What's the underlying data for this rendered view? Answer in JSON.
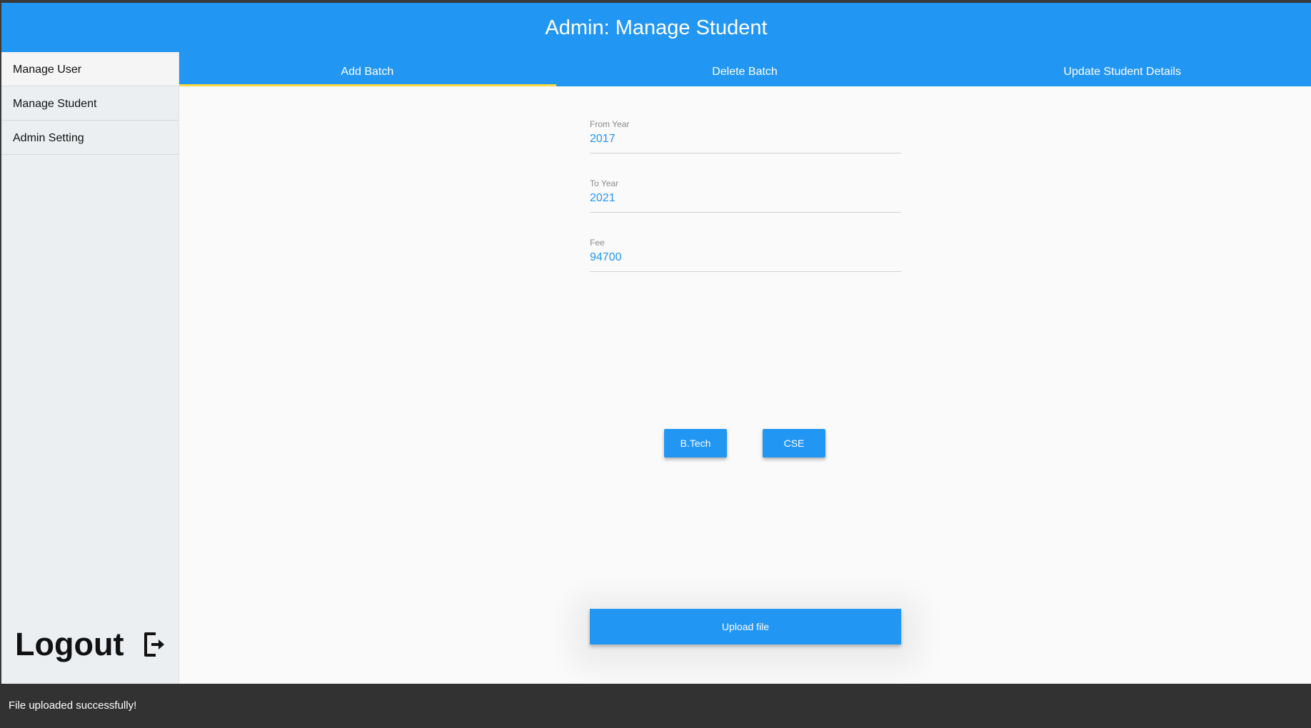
{
  "header": {
    "title": "Admin: Manage Student"
  },
  "tabs": [
    {
      "label": "Add Batch",
      "active": true
    },
    {
      "label": "Delete Batch",
      "active": false
    },
    {
      "label": "Update Student Details",
      "active": false
    }
  ],
  "sidebar": {
    "items": [
      {
        "label": "Manage User"
      },
      {
        "label": "Manage Student"
      },
      {
        "label": "Admin Setting"
      }
    ],
    "logout_label": "Logout",
    "logout_icon": "logout-icon"
  },
  "form": {
    "from_year": {
      "label": "From Year",
      "value": "2017"
    },
    "to_year": {
      "label": "To Year",
      "value": "2021"
    },
    "fee": {
      "label": "Fee",
      "value": "94700"
    },
    "course_button": "B.Tech",
    "branch_button": "CSE",
    "upload_button": "Upload file"
  },
  "snackbar": {
    "message": "File uploaded successfully!"
  },
  "colors": {
    "primary": "#2196f3",
    "tab_indicator": "#ffd740",
    "sidebar_bg": "#eceff1",
    "snackbar_bg": "#323232"
  }
}
